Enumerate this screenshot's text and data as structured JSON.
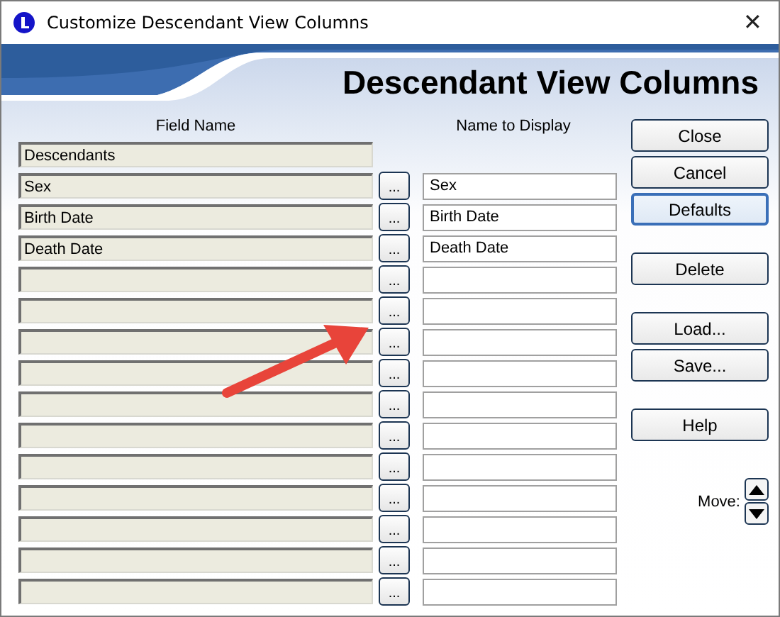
{
  "window": {
    "title": "Customize Descendant View Columns",
    "close": "✕"
  },
  "header": {
    "title": "Descendant View Columns"
  },
  "columns": {
    "field_name": "Field Name",
    "name_to_display": "Name to Display"
  },
  "rows": [
    {
      "kind": "root",
      "field": "Descendants"
    },
    {
      "kind": "column",
      "field": "Sex",
      "button": "...",
      "display": "Sex"
    },
    {
      "kind": "column",
      "field": "Birth Date",
      "button": "...",
      "display": "Birth Date"
    },
    {
      "kind": "column",
      "field": "Death Date",
      "button": "...",
      "display": "Death Date"
    },
    {
      "kind": "column",
      "button": "..."
    },
    {
      "kind": "column",
      "button": "..."
    },
    {
      "kind": "column",
      "button": "..."
    },
    {
      "kind": "column",
      "button": "..."
    },
    {
      "kind": "column",
      "button": "..."
    },
    {
      "kind": "column",
      "button": "..."
    },
    {
      "kind": "column",
      "button": "..."
    },
    {
      "kind": "column",
      "button": "..."
    },
    {
      "kind": "column",
      "button": "..."
    },
    {
      "kind": "column",
      "button": "..."
    },
    {
      "kind": "column",
      "button": "..."
    }
  ],
  "button_groups": [
    [
      {
        "label": "Close",
        "focused": false
      },
      {
        "label": "Cancel",
        "focused": false
      },
      {
        "label": "Defaults",
        "focused": true
      }
    ],
    [
      {
        "label": "Delete",
        "focused": false
      }
    ],
    [
      {
        "label": "Load...",
        "focused": false
      },
      {
        "label": "Save...",
        "focused": false
      }
    ],
    [
      {
        "label": "Help",
        "focused": false
      }
    ]
  ],
  "move": {
    "label": "Move:"
  },
  "annotation": {
    "kind": "arrow"
  }
}
